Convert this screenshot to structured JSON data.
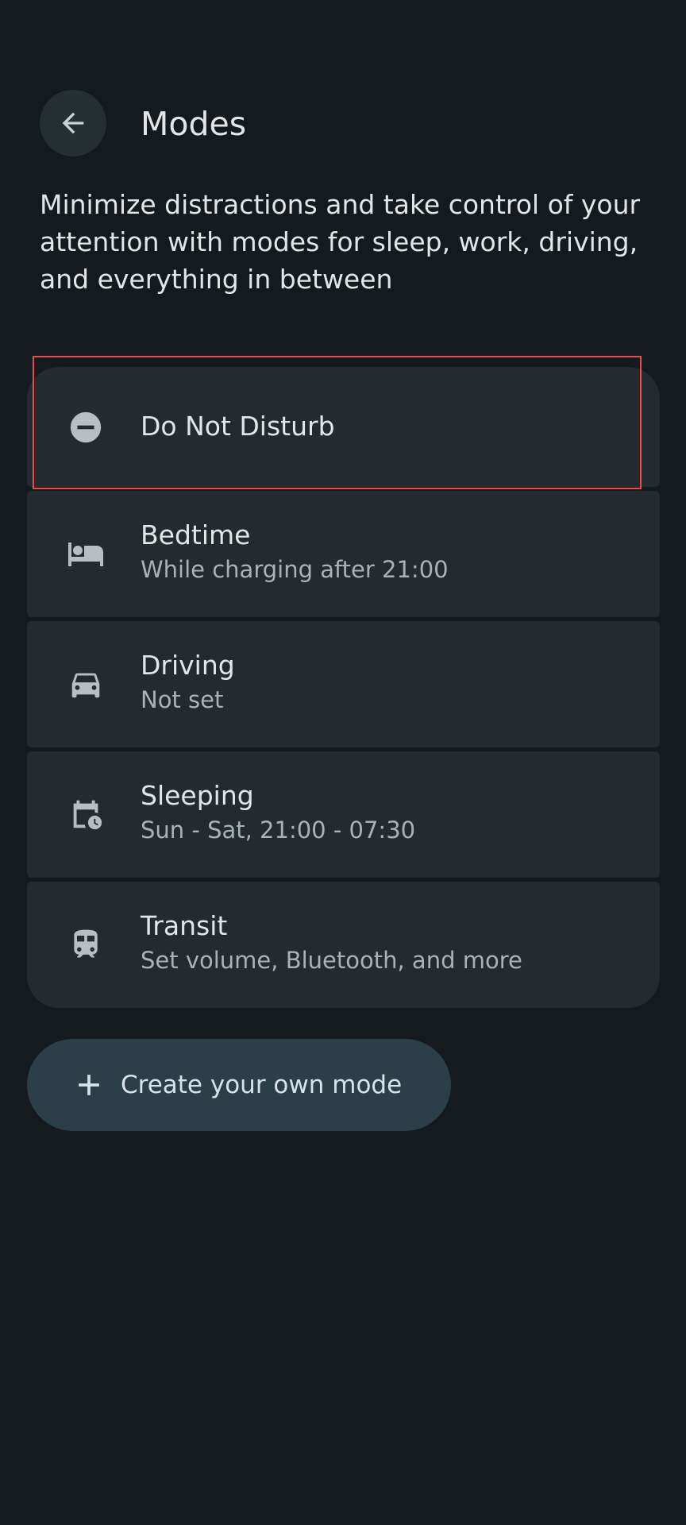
{
  "header": {
    "title": "Modes",
    "back_icon": "arrow-back-icon"
  },
  "description": "Minimize distractions and take control of your attention with modes for sleep, work, driving, and everything in between",
  "modes": [
    {
      "name": "Do Not Disturb",
      "subtitle": "",
      "icon": "minus-circle-icon"
    },
    {
      "name": "Bedtime",
      "subtitle": "While charging after 21:00",
      "icon": "bed-icon"
    },
    {
      "name": "Driving",
      "subtitle": "Not set",
      "icon": "car-icon"
    },
    {
      "name": "Sleeping",
      "subtitle": "Sun - Sat, 21:00 - 07:30",
      "icon": "calendar-clock-icon"
    },
    {
      "name": "Transit",
      "subtitle": "Set volume, Bluetooth, and more",
      "icon": "train-icon"
    }
  ],
  "create_button": {
    "label": "Create your own mode",
    "icon": "plus-icon"
  },
  "colors": {
    "background": "#141a1d",
    "card": "#242b2f",
    "text": "#e3e6e8",
    "subtext": "#a9b2b7",
    "highlight": "#e94b4b",
    "button": "#2c3e47"
  }
}
